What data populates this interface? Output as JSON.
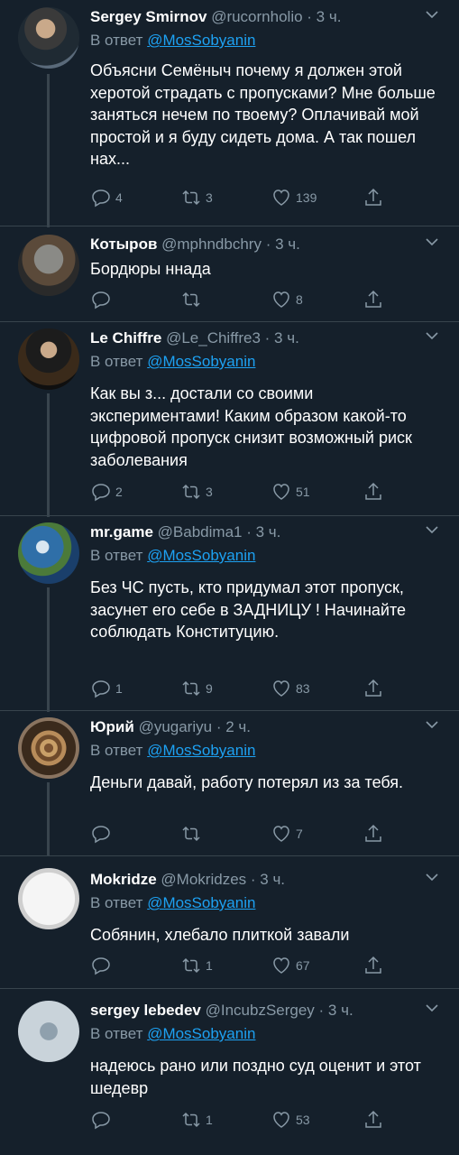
{
  "tweets": [
    {
      "name": "Sergey Smirnov",
      "handle": "@rucornholio",
      "time": "· 3 ч.",
      "reply_prefix": "В ответ",
      "reply_to": "@MosSobyanin",
      "text": "Объясни Семёныч почему я должен этой херотой страдать с пропусками? Мне больше заняться нечем по твоему? Оплачивай мой простой и я буду сидеть дома. А так пошел нах...",
      "replies": "4",
      "retweets": "3",
      "likes": "139"
    },
    {
      "name": "Котыров",
      "handle": "@mphndbchry",
      "time": "· 3 ч.",
      "reply_prefix": "",
      "reply_to": "",
      "text": "Бордюры ннада",
      "replies": "",
      "retweets": "",
      "likes": "8"
    },
    {
      "name": "Le Chiffre",
      "handle": "@Le_Chiffre3",
      "time": "· 3 ч.",
      "reply_prefix": "В ответ",
      "reply_to": "@MosSobyanin",
      "text": "Как вы з... достали со своими экспериментами! Каким образом какой-то цифровой пропуск снизит возможный риск заболевания",
      "replies": "2",
      "retweets": "3",
      "likes": "51"
    },
    {
      "name": "mr.game",
      "handle": "@Babdima1",
      "time": "· 3 ч.",
      "reply_prefix": "В ответ",
      "reply_to": "@MosSobyanin",
      "text": "Без ЧС пусть, кто придумал этот пропуск, засунет его себе в ЗАДНИЦУ ! Начинайте соблюдать Конституцию.",
      "replies": "1",
      "retweets": "9",
      "likes": "83"
    },
    {
      "name": "Юрий",
      "handle": "@yugariyu",
      "time": "· 2 ч.",
      "reply_prefix": "В ответ",
      "reply_to": "@MosSobyanin",
      "text": "Деньги давай, работу потерял из за тебя.",
      "replies": "",
      "retweets": "",
      "likes": "7"
    },
    {
      "name": "Mokridze",
      "handle": "@Mokridzes",
      "time": "· 3 ч.",
      "reply_prefix": "В ответ",
      "reply_to": "@MosSobyanin",
      "text": "Собянин, хлебало плиткой завали",
      "replies": "",
      "retweets": "1",
      "likes": "67"
    },
    {
      "name": "sergey lebedev",
      "handle": "@IncubzSergey",
      "time": "· 3 ч.",
      "reply_prefix": "В ответ",
      "reply_to": "@MosSobyanin",
      "text": "надеюсь рано или поздно суд оценит и этот шедевр",
      "replies": "",
      "retweets": "1",
      "likes": "53"
    }
  ],
  "colors": {
    "background": "#15202b",
    "secondary_text": "#8899a6",
    "link": "#1da1f2",
    "separator": "#38444d"
  }
}
